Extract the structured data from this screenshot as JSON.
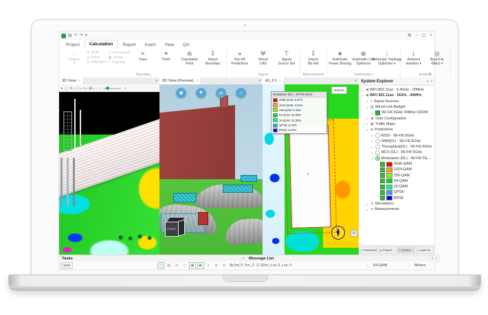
{
  "colors": {
    "accent_green": "#2e9e46",
    "selection_green": "#2fae4a",
    "panel_border": "#c9c9c9",
    "modulation": {
      "qam4096": "#ff0000",
      "qam1024": "#ffa800",
      "qam256": "#9cf000",
      "qam64": "#00e400",
      "qam16": "#00ff90",
      "qpsk": "#28a8f8",
      "bpsk": "#0000f0"
    }
  },
  "icons": {
    "save": "▤",
    "undo": "↶",
    "redo": "↷",
    "more": "▾",
    "menu": "⊞",
    "minimize": "−",
    "restore": "▢",
    "close": "×",
    "region": "◌",
    "xor": "⊗",
    "union": "⊕",
    "difference": "⊖",
    "intersection": "⊙",
    "group": "▣",
    "ungroup": "□",
    "trace": "≈",
    "point": "⌖",
    "calculation_point": "ılı",
    "import": "↧",
    "run": "»",
    "virtual_cag": "Ψ",
    "signal_source_set": "⊤",
    "ibx": "↧",
    "power_sharing": "∗",
    "cell_optimizer": "⊛",
    "topology_optimizer": "⋮",
    "antenna_isolation": "↕",
    "near_far": "◎",
    "pin": "▾",
    "options": "◦",
    "caret": "▾",
    "gear": "✱",
    "funnel": "▼",
    "swap": "⇄",
    "home": "⌂",
    "speaker": "◀",
    "signal_sources": "⌖",
    "link_budget": "▤",
    "user": "☻",
    "traffic": "▦",
    "predictions": "◈",
    "simulations": "◷",
    "measurements": "≋",
    "properties": "⊙",
    "project": "▤",
    "system": "◫",
    "layers": "≡",
    "grid": "⊞"
  },
  "titlebar": {
    "window_controls": [
      "menu",
      "minimize",
      "restore",
      "close"
    ]
  },
  "ribbon": {
    "tabs": [
      "Project",
      "Calculation",
      "Report",
      "Insert",
      "View",
      "QA"
    ],
    "active_tab": "Calculation",
    "groups": [
      {
        "label": "Boundary",
        "buttons": [
          {
            "kind": "big",
            "lines": [
              "Region",
              ""
            ],
            "icon": "region",
            "disabled": true,
            "dd": true
          },
          {
            "kind": "col",
            "items": [
              {
                "t": "XOR",
                "i": "xor"
              },
              {
                "t": "Union",
                "i": "union"
              },
              {
                "t": "Difference",
                "i": "difference"
              }
            ]
          },
          {
            "kind": "col",
            "items": [
              {
                "t": "Intersection",
                "i": "intersection"
              },
              {
                "t": "Group",
                "i": "group"
              },
              {
                "t": "Ungroup",
                "i": "ungroup"
              }
            ]
          },
          {
            "kind": "big",
            "lines": [
              "Trace",
              ""
            ],
            "icon": "trace"
          },
          {
            "kind": "big",
            "lines": [
              "Point",
              ""
            ],
            "icon": "point"
          },
          {
            "kind": "big",
            "lines": [
              "Calculation",
              "Point"
            ],
            "icon": "calculation_point"
          },
          {
            "kind": "big",
            "lines": [
              "Import",
              "Boundary"
            ],
            "icon": "import",
            "green": true
          }
        ]
      },
      {
        "label": "Signal",
        "buttons": [
          {
            "kind": "big",
            "lines": [
              "Run All",
              "Predictions"
            ],
            "icon": "run"
          },
          {
            "kind": "big",
            "lines": [
              "Virtual",
              "CAG"
            ],
            "icon": "virtual_cag"
          },
          {
            "kind": "big",
            "lines": [
              "Signal",
              "Source Set"
            ],
            "icon": "signal_source_set"
          }
        ]
      },
      {
        "label": "Measurement",
        "buttons": [
          {
            "kind": "big",
            "lines": [
              "Import",
              "iBx File"
            ],
            "icon": "ibx",
            "green": true
          }
        ]
      },
      {
        "label": "Optimization",
        "buttons": [
          {
            "kind": "big",
            "lines": [
              "Automatic",
              "Power Sharing"
            ],
            "icon": "power_sharing"
          },
          {
            "kind": "big",
            "lines": [
              "Automatic Cell",
              "Optimizer"
            ],
            "icon": "cell_optimizer"
          },
          {
            "kind": "big",
            "lines": [
              "Automatic Topology",
              "Optimizer ▾"
            ],
            "icon": "topology_optimizer"
          }
        ]
      },
      {
        "label": "Analysis",
        "buttons": [
          {
            "kind": "big",
            "lines": [
              "Antenna",
              "Isolation ▾"
            ],
            "icon": "antenna_isolation"
          },
          {
            "kind": "big",
            "lines": [
              "Near-Far",
              "Effect ▾"
            ],
            "icon": "near_far"
          }
        ]
      }
    ]
  },
  "panels": {
    "view1": {
      "tab": "3D View",
      "close": "×",
      "toolbar": [
        {
          "g": "▸"
        },
        {
          "g": "▢"
        },
        {
          "g": "∗",
          "dd": true
        },
        {
          "g": "▢",
          "dd": true
        },
        {
          "g": "≡",
          "dd": true
        },
        {
          "g": "▤",
          "dd": true
        },
        {
          "g": "▫"
        },
        {
          "g": "−"
        }
      ],
      "zoom_plus": "+",
      "zoom_minus": "−"
    },
    "view2": {
      "tab": "3D View (Preview)",
      "close": "×",
      "overlay_buttons": [
        "gear",
        "funnel",
        "swap",
        "home"
      ],
      "cube_label": "FRONT"
    },
    "map": {
      "tab": "A1_F1",
      "close": "×",
      "watermark": "Telenet",
      "legend": {
        "title": "Modulation (DL) - Wi-Fi6 5GHz",
        "items": [
          {
            "label": "4096-QAM: 8.07%",
            "color": "#ff0000"
          },
          {
            "label": "1024-QAM: 4.04%",
            "color": "#ffa800"
          },
          {
            "label": "256-QAM: 5.43%",
            "color": "#9cf000"
          },
          {
            "label": "64-QAM: 34.09%",
            "color": "#00e400"
          },
          {
            "label": "16-QAM: 21.30%",
            "color": "#00ff90"
          },
          {
            "label": "QPSK: 8.70%",
            "color": "#28a8f8"
          },
          {
            "label": "BPSK: 6.03%",
            "color": "#0000f0"
          }
        ]
      }
    }
  },
  "system_explorer": {
    "title": "System Explorer",
    "tree": [
      {
        "label": "WiFi 802.11ax - 2.4GHz - 20MHz",
        "level": 0,
        "icon": "speaker",
        "exp": "▸"
      },
      {
        "label": "WiFi 802.11ax - 5GHz - 40MHz",
        "level": 0,
        "icon": "speaker",
        "exp": "▾",
        "bold": true
      },
      {
        "label": "Signal Sources",
        "level": 1,
        "icon": "signal_sources",
        "exp": "▸"
      },
      {
        "label": "Wired Link Budget",
        "level": 1,
        "icon": "link_budget",
        "exp": "▾"
      },
      {
        "label": "Wi-Fi6 5GHz 40MHz OFDM",
        "level": 2,
        "mark": "greenbox",
        "exp": "▸"
      },
      {
        "label": "User Configuration",
        "level": 1,
        "icon": "user",
        "exp": "▸"
      },
      {
        "label": "Traffic Maps",
        "level": 1,
        "icon": "traffic",
        "exp": "▸"
      },
      {
        "label": "Predictions",
        "level": 1,
        "icon": "predictions",
        "exp": "▾"
      },
      {
        "label": "RSSI - Wi-Fi6 5GHz",
        "level": 2,
        "mark": "radio",
        "exp": "▸"
      },
      {
        "label": "SNR(DL) - Wi-Fi6 5GHz",
        "level": 2,
        "mark": "radio",
        "exp": "▸"
      },
      {
        "label": "Throughput(DL) - Wi-Fi6 5GHz",
        "level": 2,
        "mark": "radio",
        "exp": "▸"
      },
      {
        "label": "MCS (DL) - Wi-Fi6 5GHz",
        "level": 2,
        "mark": "radio",
        "exp": "▸"
      },
      {
        "label": "Modulation (DL) - Wi-Fi6 5G...",
        "level": 2,
        "mark": "radio-on",
        "exp": "▾"
      },
      {
        "label": "4096-QAM",
        "level": 3,
        "mark": "legend",
        "color": "#ff0000"
      },
      {
        "label": "1024-QAM",
        "level": 3,
        "mark": "legend",
        "color": "#ffa800"
      },
      {
        "label": "256-QAM",
        "level": 3,
        "mark": "legend",
        "color": "#9cf000"
      },
      {
        "label": "64-QAM",
        "level": 3,
        "mark": "legend",
        "color": "#00e400"
      },
      {
        "label": "16-QAM",
        "level": 3,
        "mark": "legend",
        "color": "#00ff90"
      },
      {
        "label": "QPSK",
        "level": 3,
        "mark": "legend",
        "color": "#28a8f8"
      },
      {
        "label": "BPSK",
        "level": 3,
        "mark": "legend",
        "color": "#0000f0"
      }
    ],
    "tree_tail": [
      {
        "label": "Simulations",
        "level": 1,
        "icon": "simulations",
        "exp": "▸"
      },
      {
        "label": "Measurements",
        "level": 1,
        "icon": "measurements",
        "exp": "▸"
      }
    ],
    "bottom_tabs": [
      {
        "label": "Properties",
        "icon": "properties",
        "active": false
      },
      {
        "label": "Project ...",
        "icon": "project",
        "active": false
      },
      {
        "label": "System ...",
        "icon": "system",
        "active": true
      },
      {
        "label": "Layer M...",
        "icon": "layers",
        "active": false
      }
    ]
  },
  "bottom": {
    "tasks_title": "Tasks",
    "message_list_title": "Message List",
    "dock_icons": [
      "options",
      "pin",
      "close"
    ],
    "start_label": "Start",
    "status_icons": [
      {
        "g": "▢",
        "green": true
      },
      {
        "g": "▤"
      },
      {
        "g": "◫"
      },
      {
        "g": "▱"
      },
      {
        "g": "▣",
        "green": true
      },
      {
        "g": "▣",
        "green": true
      },
      {
        "g": "▾"
      },
      {
        "g": "⊕"
      },
      {
        "g": "⊖"
      },
      {
        "g": "⊕"
      },
      {
        "g": "▢"
      }
    ],
    "coordinates": "X: 0m, Y: 0m, Z: 17.82m | Lat: 0, Lon: 0",
    "modulation_value": "64-QAM",
    "units": "Meters"
  }
}
